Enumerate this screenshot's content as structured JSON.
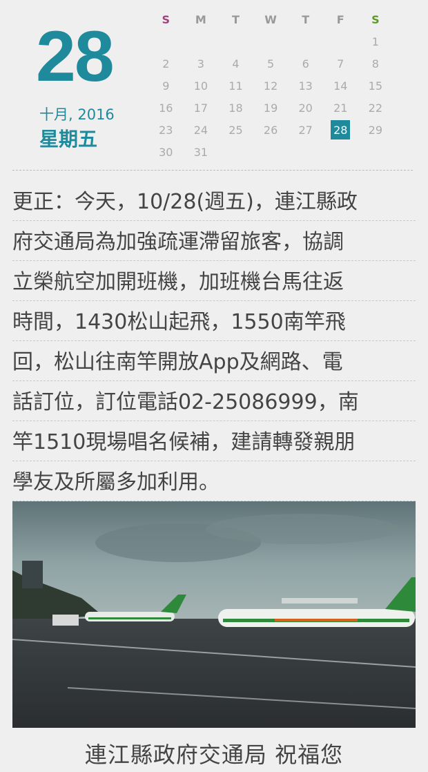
{
  "date_header": {
    "day": "28",
    "month_year": "十月, 2016",
    "weekday": "星期五"
  },
  "calendar": {
    "weekday_labels": [
      "S",
      "M",
      "T",
      "W",
      "T",
      "F",
      "S"
    ],
    "weeks": [
      [
        "",
        "",
        "",
        "",
        "",
        "",
        "1"
      ],
      [
        "2",
        "3",
        "4",
        "5",
        "6",
        "7",
        "8"
      ],
      [
        "9",
        "10",
        "11",
        "12",
        "13",
        "14",
        "15"
      ],
      [
        "16",
        "17",
        "18",
        "19",
        "20",
        "21",
        "22"
      ],
      [
        "23",
        "24",
        "25",
        "26",
        "27",
        "28",
        "29"
      ],
      [
        "30",
        "31",
        "",
        "",
        "",
        "",
        ""
      ]
    ],
    "highlighted_day": "28",
    "accent_color": "#1f8a9c"
  },
  "notice": {
    "lines": [
      "更正：今天，10/28(週五)，連江縣政",
      "府交通局為加強疏運滯留旅客，協調",
      "立榮航空加開班機，加班機台馬往返",
      "時間，1430松山起飛，1550南竿飛",
      "回，松山往南竿開放App及網路、電",
      "話訂位，訂位電話02-25086999，南",
      "竿1510現場唱名候補，建請轉發親朋",
      "學友及所屬多加利用。"
    ]
  },
  "photo": {
    "subject": "airport-apron-aircraft-photo"
  },
  "footer": {
    "text": "連江縣政府交通局  祝福您"
  }
}
